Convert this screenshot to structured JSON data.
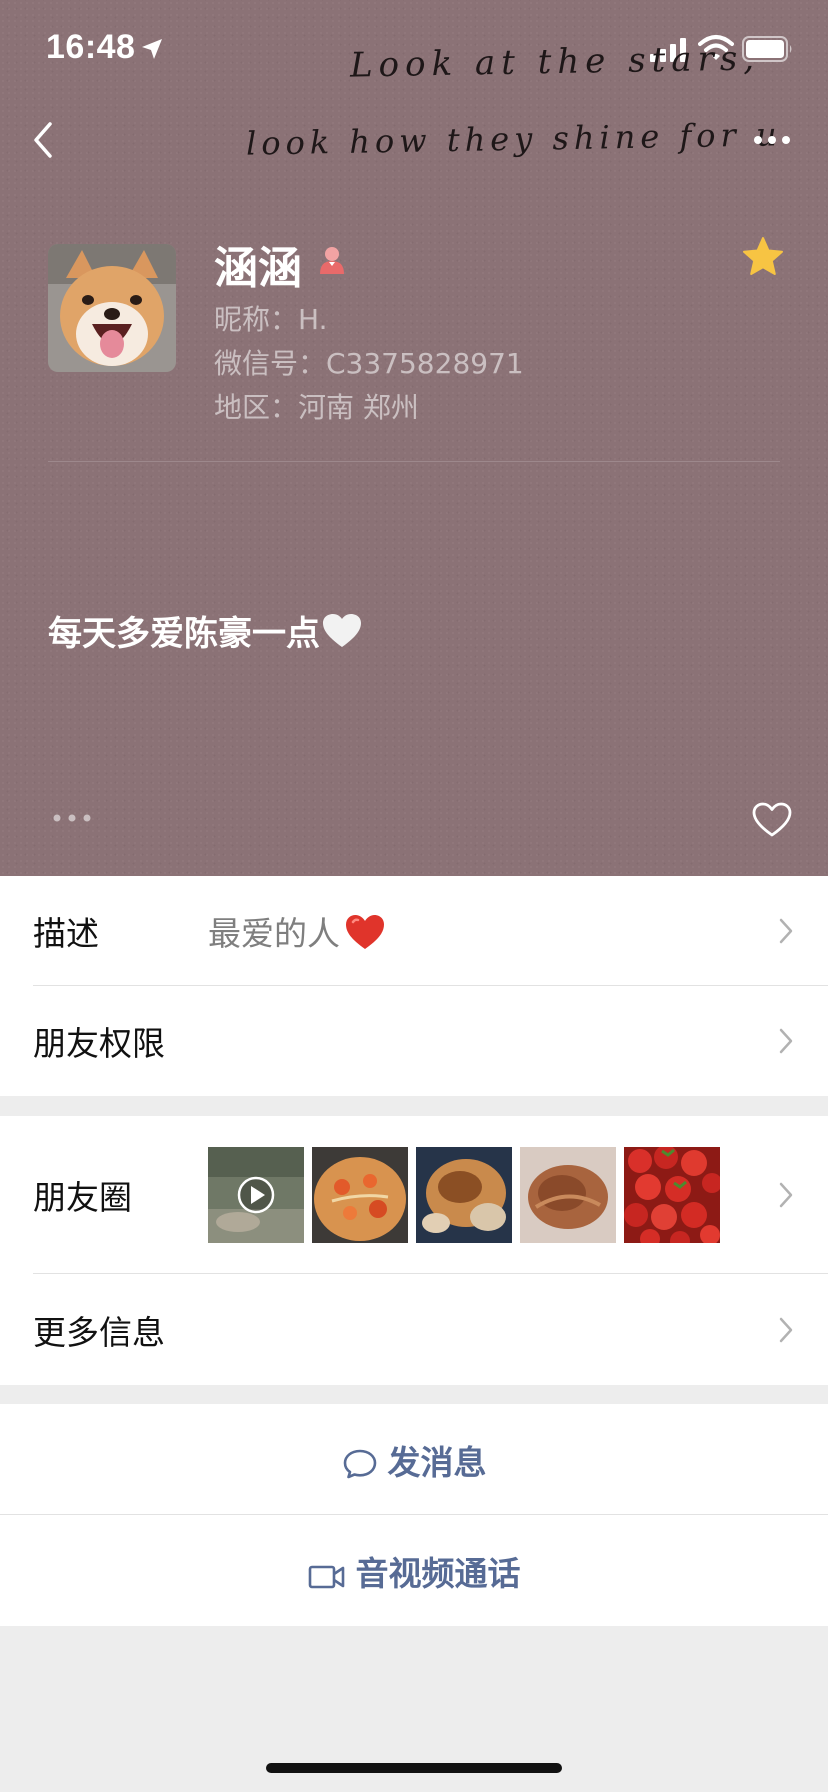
{
  "status_bar": {
    "time": "16:48"
  },
  "header": {
    "handwriting_line1": "Look at the stars,",
    "handwriting_line2": "look how they shine for u",
    "name": "涵涵",
    "nickname": "昵称：H.",
    "wechat_id": "微信号：C3375828971",
    "region": "地区：河南 郑州",
    "signature": "每天多爱陈豪一点"
  },
  "rows": {
    "description": {
      "label": "描述",
      "value": "最爱的人"
    },
    "friend_permissions": {
      "label": "朋友权限"
    },
    "moments": {
      "label": "朋友圈"
    },
    "more_info": {
      "label": "更多信息"
    }
  },
  "actions": {
    "send_message": "发消息",
    "video_call": "音视频通话"
  },
  "colors": {
    "header_bg": "#8b7276",
    "link_blue": "#576b95",
    "star": "#f7c443",
    "heart_red": "#e0342b"
  },
  "icons": [
    "location-arrow-icon",
    "signal-icon",
    "wifi-icon",
    "battery-icon",
    "back-icon",
    "more-icon",
    "gender-female-icon",
    "star-icon",
    "white-heart-icon",
    "dots-icon",
    "like-heart-icon",
    "red-heart-icon",
    "chevron-right-icon",
    "play-icon",
    "chat-bubble-icon",
    "video-camera-icon"
  ]
}
